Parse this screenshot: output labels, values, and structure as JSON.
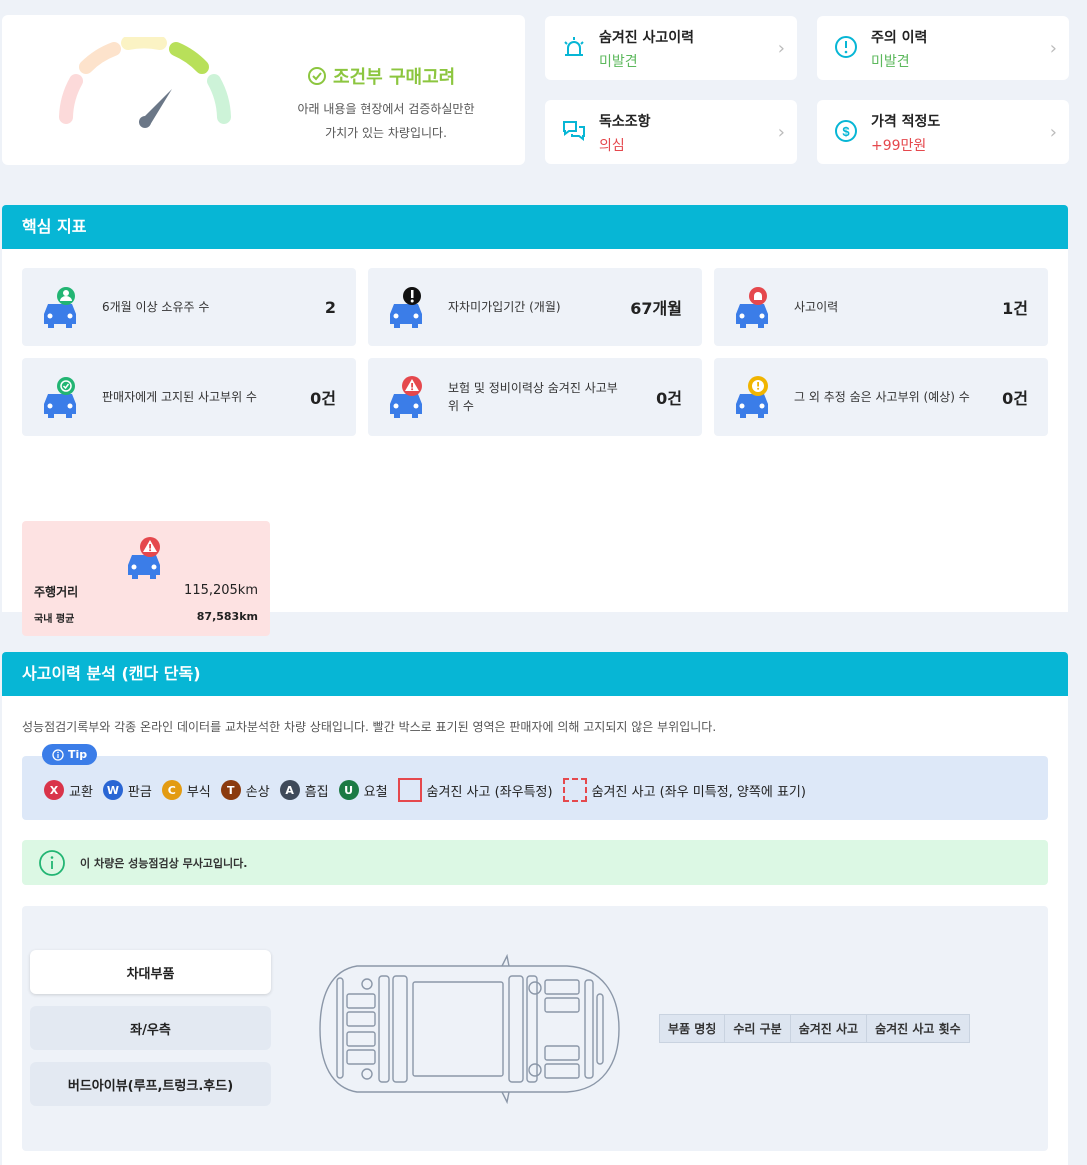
{
  "verdict": {
    "title": "조건부 구매고려",
    "desc_line1": "아래 내용을 현장에서 검증하실만한",
    "desc_line2": "가치가 있는 차량입니다."
  },
  "summary": [
    {
      "title": "숨겨진 사고이력",
      "value": "미발견",
      "icon": "siren-icon"
    },
    {
      "title": "주의 이력",
      "value": "미발견",
      "icon": "alert-circle-icon"
    },
    {
      "title": "독소조항",
      "value": "의심",
      "icon": "chat-bubbles-icon"
    },
    {
      "title": "가격 적정도",
      "value": "+99만원",
      "icon": "dollar-circle-icon"
    }
  ],
  "key_metrics": {
    "heading": "핵심 지표",
    "items": [
      {
        "label": "6개월 이상 소유주 수",
        "value": "2"
      },
      {
        "label": "자차미가입기간 (개월)",
        "value": "67개월"
      },
      {
        "label": "사고이력",
        "value": "1건"
      },
      {
        "label": "판매자에게 고지된 사고부위 수",
        "value": "0건"
      },
      {
        "label": "보험 및 정비이력상 숨겨진 사고부위 수",
        "value": "0건"
      },
      {
        "label": "그 외 추정 숨은 사고부위 (예상) 수",
        "value": "0건"
      }
    ],
    "mileage": {
      "label": "주행거리",
      "value": "115,205km",
      "avg_label": "국내 평균",
      "avg_value": "87,583km"
    }
  },
  "accident": {
    "heading": "사고이력 분석 (캔다 단독)",
    "description": "성능점검기록부와 각종 온라인 데이터를 교차분석한 차량 상태입니다. 빨간 박스로 표기된 영역은 판매자에 의해 고지되지 않은 부위입니다.",
    "tip": "Tip",
    "legend": [
      {
        "code": "X",
        "label": "교환",
        "color": "#d9344a"
      },
      {
        "code": "W",
        "label": "판금",
        "color": "#2a66d4"
      },
      {
        "code": "C",
        "label": "부식",
        "color": "#e39b12"
      },
      {
        "code": "T",
        "label": "손상",
        "color": "#8b3a0e"
      },
      {
        "code": "A",
        "label": "흠집",
        "color": "#3f4a5a"
      },
      {
        "code": "U",
        "label": "요철",
        "color": "#1c7a44"
      }
    ],
    "legend_solid": "숨겨진 사고 (좌우특정)",
    "legend_dashed": "숨겨진 사고 (좌우 미특정, 양쪽에 표기)",
    "notice": "이 차량은 성능점검상 무사고입니다.",
    "views": [
      "차대부품",
      "좌/우측",
      "버드아이뷰(루프,트렁크.후드)"
    ],
    "table_headers": [
      "부품 명칭",
      "수리 구분",
      "숨겨진 사고",
      "숨겨진 사고 횟수"
    ]
  }
}
